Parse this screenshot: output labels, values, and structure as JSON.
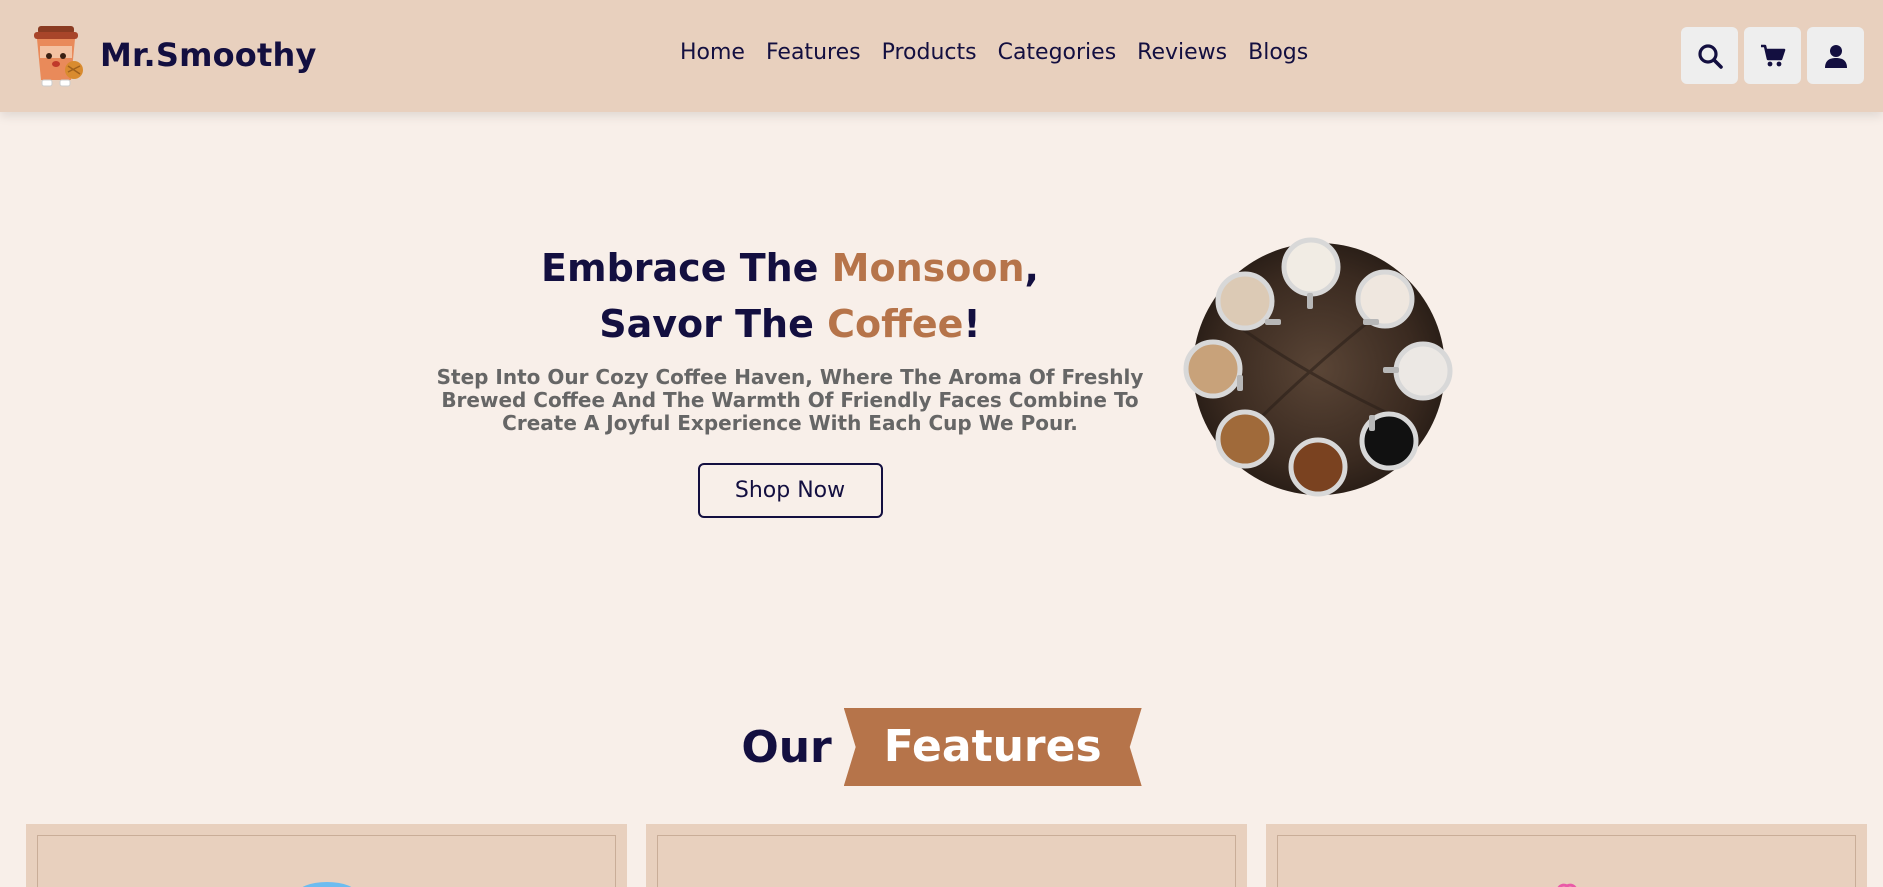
{
  "brand": {
    "name": "Mr.Smoothy",
    "logo_icon": "coffee-cup-mascot-icon"
  },
  "nav": {
    "items": [
      {
        "label": "Home"
      },
      {
        "label": "Features"
      },
      {
        "label": "Products"
      },
      {
        "label": "Categories"
      },
      {
        "label": "Reviews"
      },
      {
        "label": "Blogs"
      }
    ]
  },
  "header_icons": [
    {
      "name": "search-icon"
    },
    {
      "name": "cart-icon"
    },
    {
      "name": "user-icon"
    }
  ],
  "hero": {
    "title_line1_part1": "Embrace The ",
    "title_line1_accent": "Monsoon",
    "title_line1_part2": ",",
    "title_line2_part1": "Savor The ",
    "title_line2_accent": "Coffee",
    "title_line2_part2": "!",
    "description": "Step Into Our Cozy Coffee Haven, Where The Aroma Of Freshly Brewed Coffee And The Warmth Of Friendly Faces Combine To Create A Joyful Experience With Each Cup We Pour.",
    "button_label": "Shop Now",
    "image": "coffee-cups-on-round-table-image"
  },
  "features": {
    "heading_plain": "Our",
    "heading_ribbon": "Features",
    "cards": [
      {
        "name": "feature-card-1"
      },
      {
        "name": "feature-card-2"
      },
      {
        "name": "feature-card-3"
      }
    ]
  },
  "colors": {
    "header_bg": "#e8d0be",
    "page_bg": "#f8efe9",
    "primary_text": "#130f40",
    "accent": "#b6744a",
    "muted_text": "#666666"
  }
}
